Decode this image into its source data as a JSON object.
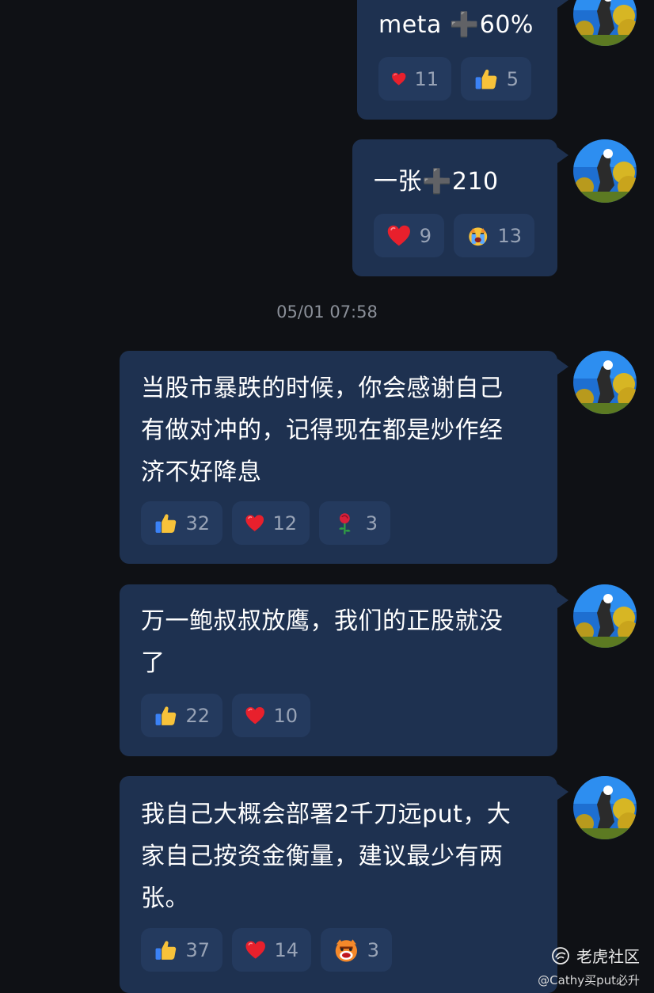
{
  "timestamp": "05/01 07:58",
  "messages": [
    {
      "parts": [
        "meta ",
        "➕",
        "60%"
      ],
      "reactions": [
        {
          "icon": "heart-icon",
          "count": "11"
        },
        {
          "icon": "thumbs-up-icon",
          "count": "5"
        }
      ]
    },
    {
      "parts": [
        "一张",
        "➕",
        "210"
      ],
      "reactions": [
        {
          "icon": "heart-icon",
          "count": "9"
        },
        {
          "icon": "crying-face-icon",
          "count": "13"
        }
      ]
    },
    {
      "lines": [
        "当股市暴跌的时候，你会感谢自己",
        "有做对冲的，记得现在都是炒作经",
        "济不好降息"
      ],
      "reactions": [
        {
          "icon": "thumbs-up-icon",
          "count": "32"
        },
        {
          "icon": "heart-icon",
          "count": "12"
        },
        {
          "icon": "rose-icon",
          "count": "3"
        }
      ]
    },
    {
      "lines": [
        "万一鲍叔叔放鹰，我们的正股就没",
        "了"
      ],
      "reactions": [
        {
          "icon": "thumbs-up-icon",
          "count": "22"
        },
        {
          "icon": "heart-icon",
          "count": "10"
        }
      ]
    },
    {
      "lines": [
        "我自己大概会部署2千刀远put，大",
        "家自己按资金衡量，建议最少有两",
        "张。"
      ],
      "reactions": [
        {
          "icon": "thumbs-up-icon",
          "count": "37"
        },
        {
          "icon": "heart-icon",
          "count": "14"
        },
        {
          "icon": "angry-tiger-icon",
          "count": "3"
        }
      ]
    }
  ],
  "watermark": {
    "brand": "老虎社区",
    "user": "@Cathy买put必升"
  },
  "colors": {
    "background": "#0f1115",
    "bubble": "#1e3150",
    "chip": "#243a5e",
    "count_text": "#98a3b6"
  }
}
